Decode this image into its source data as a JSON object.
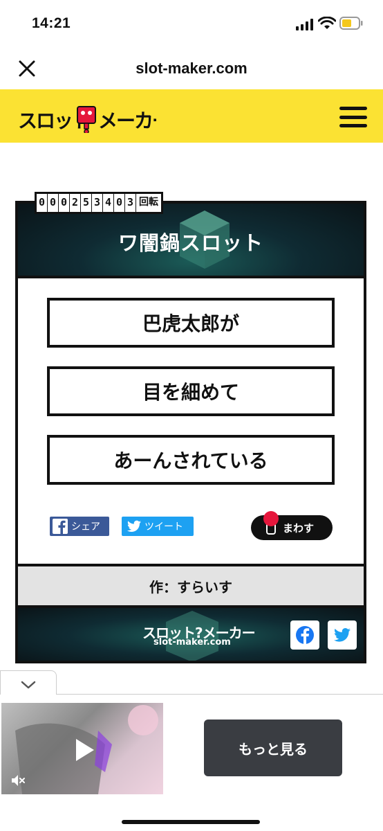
{
  "status_bar": {
    "time": "14:21"
  },
  "browser": {
    "url": "slot-maker.com"
  },
  "site": {
    "logo_text": "スロット?メーカー"
  },
  "slot": {
    "counter_digits": [
      "0",
      "0",
      "0",
      "2",
      "5",
      "3",
      "4",
      "0",
      "3"
    ],
    "counter_unit": "回転",
    "title": "ワ闇鍋スロット",
    "reels": [
      "巴虎太郎が",
      "目を細めて",
      "あーんされている"
    ],
    "share_facebook": "シェア",
    "share_twitter": "ツイート",
    "spin_label": "まわす",
    "author": "作：すらいす",
    "footer_logo": "スロット?メーカー",
    "footer_domain": "slot-maker.com"
  },
  "ad": {
    "more_button": "もっと見る"
  },
  "colors": {
    "header_yellow": "#fbe233",
    "spin_red": "#e5173c",
    "facebook": "#3b5998",
    "twitter": "#1da1f2"
  }
}
